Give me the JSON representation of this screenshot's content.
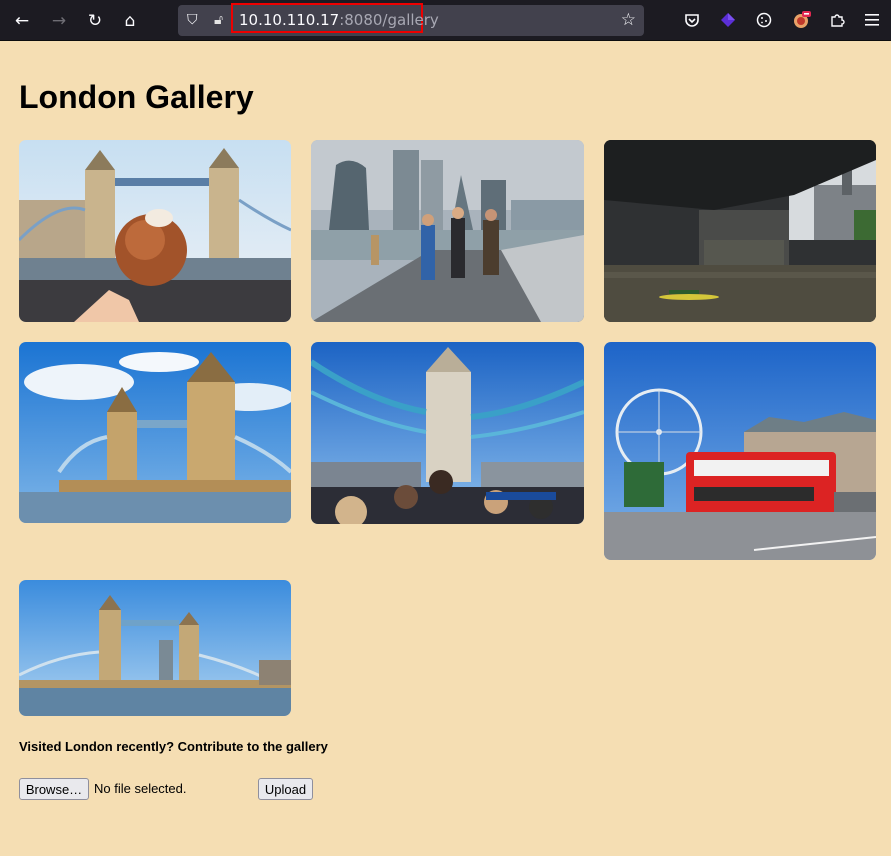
{
  "browser": {
    "url_host": "10.10.110.17",
    "url_path": ":8080/gallery",
    "back_icon": "arrow-left",
    "forward_icon": "arrow-right",
    "reload_icon": "reload",
    "home_icon": "home",
    "toolbar_icons": [
      "pocket",
      "extension-purple",
      "cookie",
      "extension-badge",
      "extensions",
      "menu"
    ]
  },
  "page": {
    "title": "London Gallery",
    "photos": [
      {
        "alt": "Tower Bridge with pastry"
      },
      {
        "alt": "City walkway with skyscrapers"
      },
      {
        "alt": "Under London Bridge"
      },
      {
        "alt": "Tower Bridge sunny"
      },
      {
        "alt": "Tower Bridge from bus"
      },
      {
        "alt": "London Eye and red bus"
      },
      {
        "alt": "Tower Bridge wide view"
      }
    ],
    "contribute_text": "Visited London recently? Contribute to the gallery",
    "browse_label": "Browse…",
    "no_file_text": "No file selected.",
    "upload_label": "Upload"
  },
  "colors": {
    "page_bg": "#f5deb3",
    "highlight": "#ee0000"
  }
}
